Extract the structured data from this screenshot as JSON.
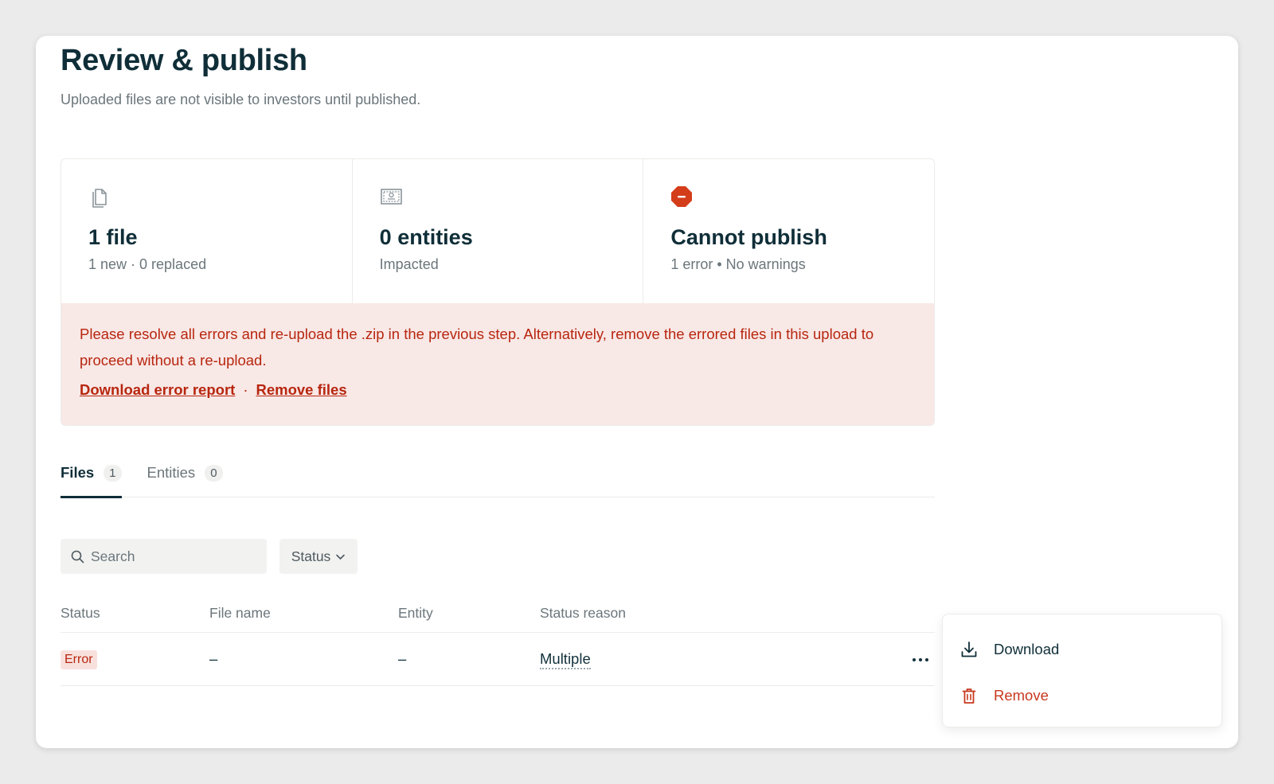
{
  "page": {
    "title": "Review & publish",
    "subtitle": "Uploaded files are not visible to investors until published."
  },
  "summary": {
    "files": {
      "icon": "files-icon",
      "value": "1 file",
      "sub": "1 new · 0 replaced"
    },
    "entities": {
      "icon": "certificate-icon",
      "value": "0 entities",
      "sub": "Impacted"
    },
    "publish": {
      "icon": "stop-error-icon",
      "value": "Cannot publish",
      "sub": "1 error • No warnings",
      "color": "#d43d1a"
    }
  },
  "alert": {
    "text": "Please resolve all errors and re-upload the .zip in the previous step. Alternatively, remove the errored files in this upload to proceed without a re-upload.",
    "download_link": "Download error report",
    "separator": "·",
    "remove_link": "Remove files",
    "background": "#f8e8e6",
    "color": "#b8260f"
  },
  "tabs": [
    {
      "label": "Files",
      "count": "1",
      "active": true
    },
    {
      "label": "Entities",
      "count": "0",
      "active": false
    }
  ],
  "filters": {
    "search_placeholder": "Search",
    "status_label": "Status"
  },
  "table": {
    "columns": [
      "Status",
      "File name",
      "Entity",
      "Status reason"
    ],
    "rows": [
      {
        "status": "Error",
        "file_name": "–",
        "entity": "–",
        "status_reason": "Multiple"
      }
    ]
  },
  "menu": {
    "download": "Download",
    "remove": "Remove"
  }
}
